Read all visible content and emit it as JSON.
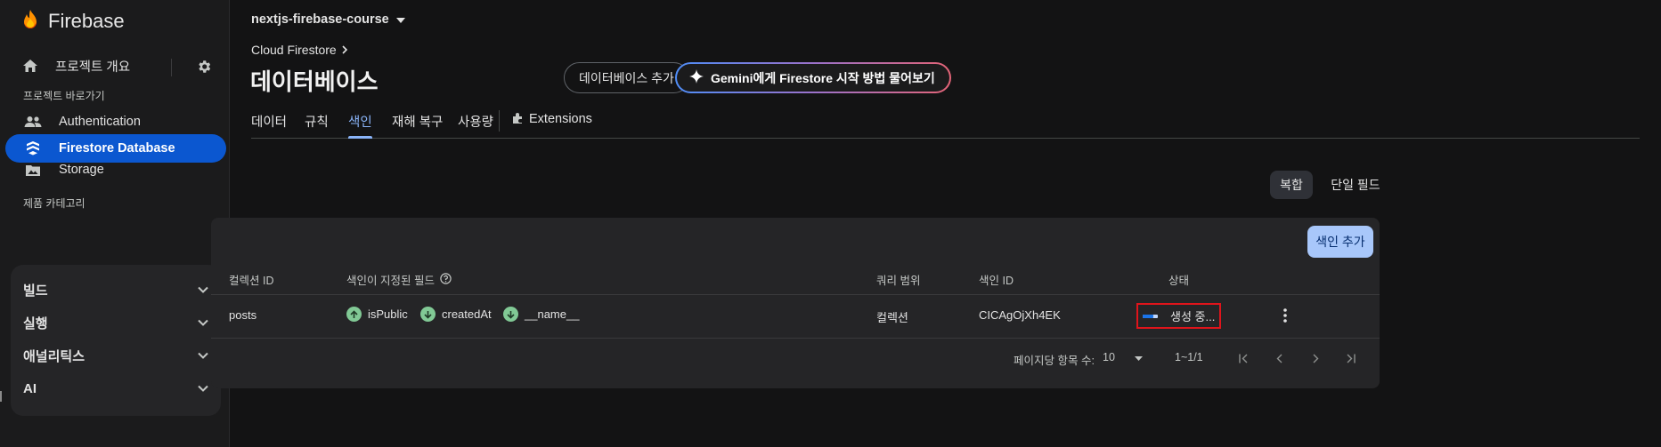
{
  "brand": {
    "name": "Firebase"
  },
  "sidebar": {
    "overview_label": "프로젝트 개요",
    "shortcuts_label": "프로젝트 바로가기",
    "shortcuts": [
      {
        "label": "Authentication",
        "icon": "people-icon",
        "active": false
      },
      {
        "label": "Firestore Database",
        "icon": "firestore-icon",
        "active": true
      },
      {
        "label": "Storage",
        "icon": "image-folder-icon",
        "active": false
      }
    ],
    "categories_label": "제품 카테고리",
    "categories": [
      {
        "label": "빌드"
      },
      {
        "label": "실행"
      },
      {
        "label": "애널리틱스"
      },
      {
        "label": "AI"
      }
    ]
  },
  "header": {
    "project_name": "nextjs-firebase-course",
    "breadcrumb": "Cloud Firestore",
    "title": "데이터베이스",
    "add_db_label": "데이터베이스 추가",
    "gemini_label": "Gemini에게 Firestore 시작 방법 물어보기"
  },
  "tabs": [
    {
      "label": "데이터",
      "active": false
    },
    {
      "label": "규칙",
      "active": false
    },
    {
      "label": "색인",
      "active": true
    },
    {
      "label": "재해 복구",
      "active": false
    },
    {
      "label": "사용량",
      "active": false
    },
    {
      "label": "Extensions",
      "active": false
    }
  ],
  "segment": {
    "compound": "복합",
    "single_field": "단일 필드",
    "selected": "복합"
  },
  "table": {
    "add_index_label": "색인 추가",
    "headers": {
      "collection_id": "컬렉션 ID",
      "indexed_fields": "색인이 지정된 필드",
      "query_scope": "쿼리 범위",
      "index_id": "색인 ID",
      "status": "상태"
    },
    "rows": [
      {
        "collection_id": "posts",
        "fields": [
          {
            "name": "isPublic",
            "direction": "ascending"
          },
          {
            "name": "createdAt",
            "direction": "descending"
          },
          {
            "name": "__name__",
            "direction": "descending"
          }
        ],
        "query_scope": "컬렉션",
        "index_id": "CICAgOjXh4EK",
        "status": "생성 중...",
        "progress": 0.7
      }
    ],
    "pagination": {
      "rows_per_page_label": "페이지당 항목 수:",
      "rows_per_page": "10",
      "range": "1~1/1"
    }
  },
  "colors": {
    "active_nav": "#0b57d0",
    "accent_tab": "#8ab4f8",
    "add_index_button": "#a8c7fa",
    "direction_icon": "#81c995",
    "highlight_border": "#e0141b"
  }
}
